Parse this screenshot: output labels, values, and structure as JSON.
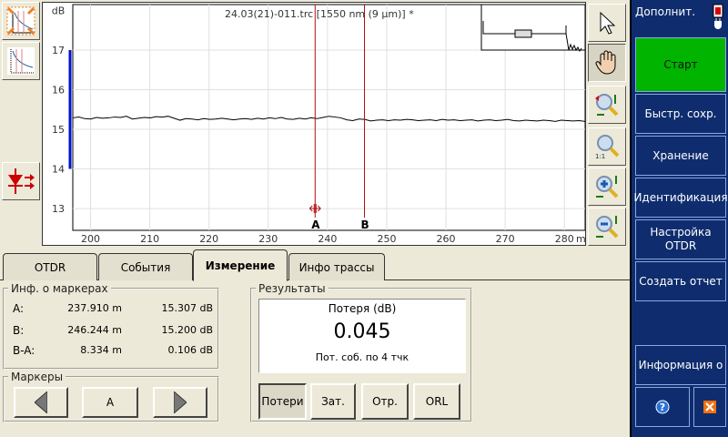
{
  "plot": {
    "title": "24.03(21)-011.trc [1550 nm (9 µm)] *",
    "y_unit": "dB",
    "x_unit": "m",
    "y_ticks": [
      13,
      14,
      15,
      16,
      17
    ],
    "x_ticks": [
      200,
      210,
      220,
      230,
      240,
      250,
      260,
      270,
      280
    ],
    "xlim": [
      197,
      283.5
    ],
    "ylim": [
      12.45,
      18.15
    ],
    "markers": [
      {
        "label": "A",
        "pos": 237.91
      },
      {
        "label": "B",
        "pos": 246.244
      }
    ],
    "marker_color": "#b01010",
    "trace": [
      15.29,
      15.31,
      15.27,
      15.26,
      15.3,
      15.28,
      15.29,
      15.31,
      15.3,
      15.33,
      15.26,
      15.28,
      15.3,
      15.29,
      15.32,
      15.31,
      15.33,
      15.28,
      15.23,
      15.27,
      15.26,
      15.24,
      15.27,
      15.25,
      15.26,
      15.28,
      15.26,
      15.24,
      15.26,
      15.27,
      15.25,
      15.28,
      15.26,
      15.29,
      15.27,
      15.3,
      15.26,
      15.25,
      15.28,
      15.26,
      15.29,
      15.27,
      15.3,
      15.33,
      15.31,
      15.29,
      15.24,
      15.22,
      15.26,
      15.25,
      15.21,
      15.23,
      15.24,
      15.22,
      15.24,
      15.23,
      15.25,
      15.24,
      15.22,
      15.23,
      15.24,
      15.22,
      15.25,
      15.23,
      15.24,
      15.22,
      15.23,
      15.24,
      15.21,
      15.23,
      15.24,
      15.22,
      15.23,
      15.25,
      15.22,
      15.21,
      15.23,
      15.22,
      15.21,
      15.23,
      15.22,
      15.2,
      15.23,
      15.22,
      15.21,
      15.22,
      15.2
    ]
  },
  "tabs": [
    {
      "label": "OTDR"
    },
    {
      "label": "События"
    },
    {
      "label": "Измерение"
    },
    {
      "label": "Инфо трассы"
    }
  ],
  "marker_info": {
    "legend": "Инф. о маркерах",
    "rows": [
      {
        "label": "A:",
        "dist": "237.910 m",
        "loss": "15.307 dB"
      },
      {
        "label": "B:",
        "dist": "246.244 m",
        "loss": "15.200 dB"
      },
      {
        "label": "B-A:",
        "dist": "8.334 m",
        "loss": "0.106 dB"
      }
    ]
  },
  "markers_panel": {
    "legend": "Маркеры",
    "current": "A"
  },
  "results": {
    "legend": "Результаты",
    "heading": "Потеря (dB)",
    "value": "0.045",
    "method": "Пот. соб. по 4 тчк",
    "buttons": [
      "Потери",
      "Зат.",
      "Отр.",
      "ORL"
    ]
  },
  "side": {
    "title": "Дополнит.",
    "start": "Старт",
    "start_color": "#00b400",
    "items": [
      "Быстр. сохр.",
      "Хранение",
      "Идентификация",
      "Настройка OTDR",
      "Создать отчет"
    ],
    "info": "Информация о"
  }
}
